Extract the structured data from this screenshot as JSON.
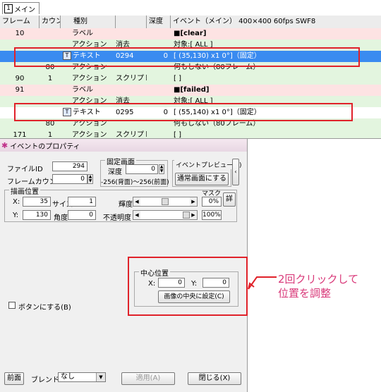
{
  "list": {
    "tab_num": "1",
    "tab_label": "メイン",
    "headers": [
      "フレーム",
      "カウント",
      "種別",
      "",
      "深度",
      "イベント（メイン） 400×400 60fps SWF8"
    ],
    "rows": [
      {
        "frame": "10",
        "count": "",
        "type": "ラベル",
        "name": "",
        "depth": "",
        "event": "■[clear]",
        "bg": "red"
      },
      {
        "frame": "",
        "count": "",
        "type": "アクション",
        "name": "消去",
        "depth": "",
        "event": "対象:[ ALL ]",
        "bg": "green"
      },
      {
        "frame": "",
        "count": "",
        "type": "テキスト",
        "name": "0294",
        "depth": "0",
        "event": "[   (35,130)         x1    0°]（固定）",
        "bg": "sel"
      },
      {
        "frame": "",
        "count": "80",
        "type": "アクション",
        "name": "",
        "depth": "",
        "event": "何もしない（80フレーム）",
        "bg": "green"
      },
      {
        "frame": "90",
        "count": "1",
        "type": "アクション",
        "name": "スクリプト",
        "depth": "",
        "event": "[  ]",
        "bg": "green"
      },
      {
        "frame": "91",
        "count": "",
        "type": "ラベル",
        "name": "",
        "depth": "",
        "event": "■[failed]",
        "bg": "red"
      },
      {
        "frame": "",
        "count": "",
        "type": "アクション",
        "name": "消去",
        "depth": "",
        "event": "対象:[ ALL ]",
        "bg": "green"
      },
      {
        "frame": "",
        "count": "",
        "type": "テキスト",
        "name": "0295",
        "depth": "0",
        "event": "[   (55,140)          x1    0°]（固定）",
        "bg": "white"
      },
      {
        "frame": "",
        "count": "80",
        "type": "アクション",
        "name": "",
        "depth": "",
        "event": "何もしない（80フレーム）",
        "bg": "green"
      },
      {
        "frame": "171",
        "count": "1",
        "type": "アクション",
        "name": "スクリプト",
        "depth": "",
        "event": "[  ]",
        "bg": "green"
      }
    ]
  },
  "dialog": {
    "title": "イベントのプロパティ",
    "file_id_label": "ファイルID",
    "file_id": "294",
    "frame_count_label": "フレームカウント",
    "frame_count": "0",
    "fixed_screen_title": "固定画面",
    "depth_label": "深度",
    "depth": "0",
    "depth_range": "-256(背面)～256(前面)",
    "preview_button": "イベントプレビュー(P)",
    "normal_screen_button": "通常画面にする",
    "draw_pos_title": "描画位置",
    "x_label": "X:",
    "x": "35",
    "y_label": "Y:",
    "y": "130",
    "size_label": "サイズ",
    "size": "1",
    "angle_label": "角度",
    "angle": "0",
    "mask_label": "マスク",
    "brightness_label": "輝度",
    "brightness": "0%",
    "opacity_label": "不透明度",
    "opacity": "100%",
    "detail_button": "詳",
    "center_title": "中心位置",
    "cx_label": "X:",
    "cx": "0",
    "cy_label": "Y:",
    "cy": "0",
    "center_button": "画像の中央に設定(C)",
    "button_check_label": "ボタンにする(B)",
    "front_label": "前面",
    "blend_label": "ブレンド",
    "blend_value": "なし",
    "apply_button": "適用(A)",
    "close_button": "閉じる(X)"
  },
  "annotation": {
    "line1": "2回クリックして",
    "line2": "位置を調整"
  },
  "colors": {
    "highlight": "#e0222a",
    "annotation_text": "#d93a7a",
    "selected_row": "#3a8bf0"
  }
}
